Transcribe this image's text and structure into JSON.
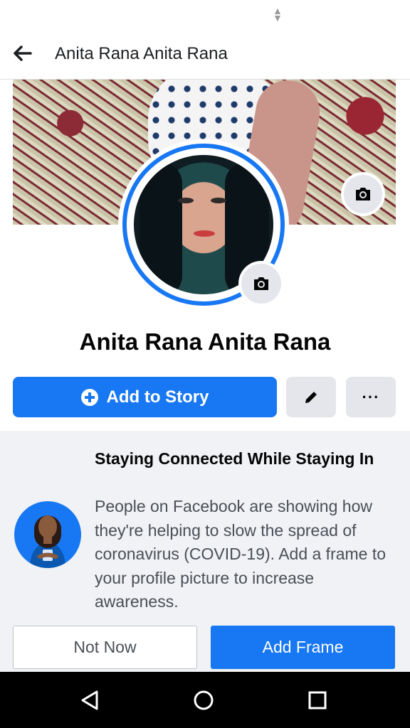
{
  "status_bar": {
    "indicator": "sort-arrows-icon"
  },
  "header": {
    "title": "Anita Rana Anita Rana",
    "back_icon": "arrow-left-icon"
  },
  "profile": {
    "name": "Anita Rana Anita Rana",
    "cover_camera_icon": "camera-icon",
    "avatar_camera_icon": "camera-icon"
  },
  "actions": {
    "add_story_label": "Add to Story",
    "edit_icon": "pencil-icon",
    "more_label": "···"
  },
  "promo": {
    "title": "Staying Connected While Staying In",
    "body": "People on Facebook are showing how they're helping to slow the spread of coronavirus (COVID-19). Add a frame to your profile picture to increase awareness.",
    "not_now_label": "Not Now",
    "add_frame_label": "Add Frame"
  },
  "nav": {
    "back": "triangle-back-icon",
    "home": "circle-home-icon",
    "recents": "square-recents-icon"
  },
  "colors": {
    "accent": "#1877f2",
    "button_gray": "#e4e6eb",
    "promo_bg": "#f0f2f5"
  }
}
